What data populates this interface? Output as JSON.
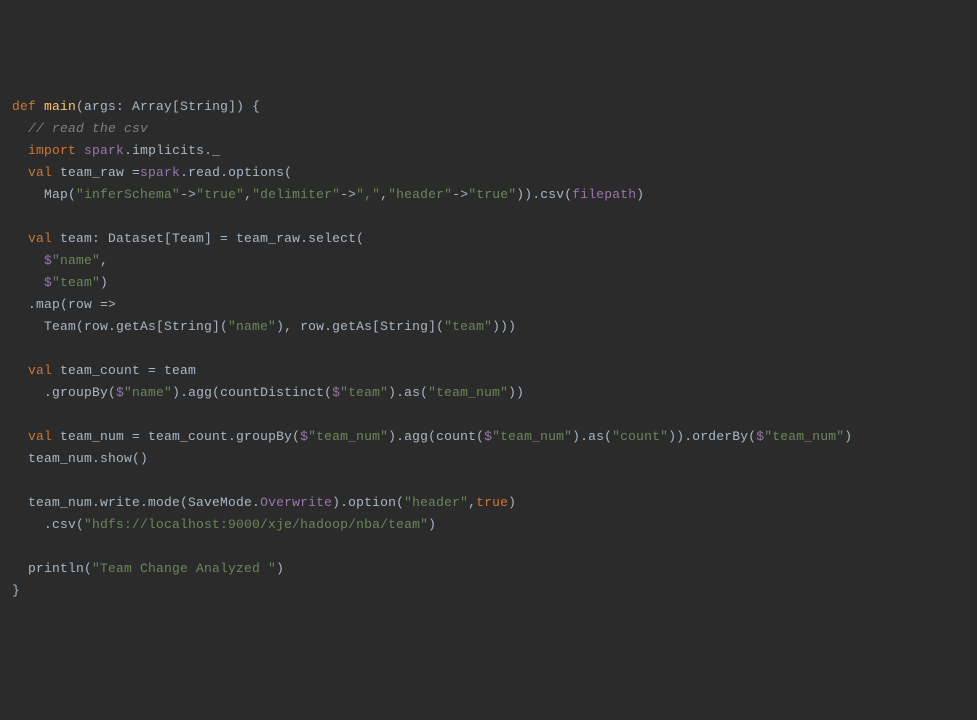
{
  "code": {
    "l1_def": "def",
    "l1_main": "main",
    "l1_args": "(args: Array[String]) {",
    "l2_cmt": "// read the csv",
    "l3_import": "import",
    "l3_spark": "spark",
    "l3_impl": ".implicits._",
    "l4_val": "val",
    "l4_rest1": " team_raw =",
    "l4_spark": "spark",
    "l4_rest2": ".read.options(",
    "l5_map": "Map(",
    "l5_s1": "\"inferSchema\"",
    "l5_arrow1": "->",
    "l5_s2": "\"true\"",
    "l5_c1": ",",
    "l5_s3": "\"delimiter\"",
    "l5_arrow2": "->",
    "l5_s4": "\",\"",
    "l5_c2": ",",
    "l5_s5": "\"header\"",
    "l5_arrow3": "->",
    "l5_s6": "\"true\"",
    "l5_close": ")).csv(",
    "l5_fp": "filepath",
    "l5_end": ")",
    "l7_val": "val",
    "l7_rest": " team: Dataset[Team] = team_raw.select(",
    "l8_dollar": "$",
    "l8_s": "\"name\"",
    "l8_c": ",",
    "l9_dollar": "$",
    "l9_s": "\"team\"",
    "l9_end": ")",
    "l10_map": ".map(row =>",
    "l11_team": "Team(row.getAs[String](",
    "l11_s1": "\"name\"",
    "l11_mid": "), row.getAs[String](",
    "l11_s2": "\"team\"",
    "l11_end": ")))",
    "l13_val": "val",
    "l13_rest": " team_count = team",
    "l14_a": ".groupBy(",
    "l14_d1": "$",
    "l14_s1": "\"name\"",
    "l14_b": ").agg(countDistinct(",
    "l14_d2": "$",
    "l14_s2": "\"team\"",
    "l14_c": ").as(",
    "l14_s3": "\"team_num\"",
    "l14_end": "))",
    "l16_val": "val",
    "l16_a": " team_num = team_count.groupBy(",
    "l16_d1": "$",
    "l16_s1": "\"team_num\"",
    "l16_b": ").agg(count(",
    "l16_d2": "$",
    "l16_s2": "\"team_num\"",
    "l16_c": ").as(",
    "l16_s3": "\"count\"",
    "l16_d": ")).orderBy(",
    "l16_d3": "$",
    "l16_s4": "\"team_num\"",
    "l16_end": ")",
    "l17": "team_num.show()",
    "l19_a": "team_num.write.mode(SaveMode.",
    "l19_over": "Overwrite",
    "l19_b": ").option(",
    "l19_s1": "\"header\"",
    "l19_c": ",",
    "l19_true": "true",
    "l19_end": ")",
    "l20_a": ".csv(",
    "l20_s": "\"hdfs://localhost:9000/xje/hadoop/nba/team\"",
    "l20_end": ")",
    "l22_a": "println(",
    "l22_s": "\"Team Change Analyzed \"",
    "l22_end": ")",
    "l23": "}"
  }
}
